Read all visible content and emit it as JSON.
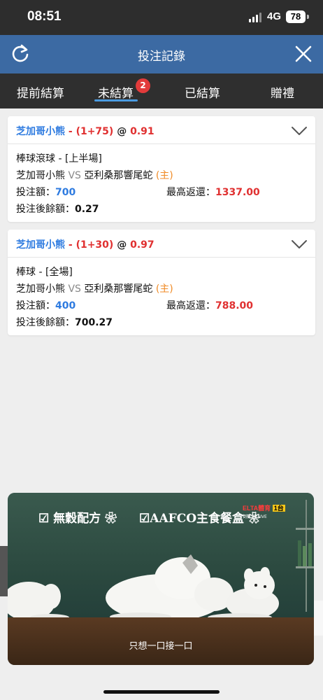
{
  "status_bar": {
    "time": "08:51",
    "network": "4G",
    "battery": "78"
  },
  "header": {
    "title": "投注記錄",
    "refresh_icon": "refresh-icon",
    "close_icon": "close-icon"
  },
  "tabs": [
    {
      "label": "提前結算",
      "active": false
    },
    {
      "label": "未結算",
      "active": true,
      "badge": "2"
    },
    {
      "label": "已結算",
      "active": false
    },
    {
      "label": "贈禮",
      "active": false
    }
  ],
  "bets": [
    {
      "team": "芝加哥小熊",
      "sep": " - ",
      "handicap": "(1+75)",
      "at": " @ ",
      "odds": "0.91",
      "market": "棒球滾球 - [上半場]",
      "home_team": "芝加哥小熊",
      "vs": " VS ",
      "away_team": "亞利桑那響尾蛇",
      "home_tag": " (主)",
      "stake_label": "投注額：",
      "stake": "700",
      "max_return_label": "最高返還：",
      "max_return": "1337.00",
      "balance_label": "投注後餘額：",
      "balance": "0.27"
    },
    {
      "team": "芝加哥小熊",
      "sep": " - ",
      "handicap": "(1+30)",
      "at": " @ ",
      "odds": "0.97",
      "market": "棒球 - [全場]",
      "home_team": "芝加哥小熊",
      "vs": " VS ",
      "away_team": "亞利桑那響尾蛇",
      "home_tag": " (主)",
      "stake_label": "投注額：",
      "stake": "400",
      "max_return_label": "最高返還：",
      "max_return": "788.00",
      "balance_label": "投注後餘額：",
      "balance": "700.27"
    }
  ],
  "ad": {
    "slogan_1": "無穀配方",
    "slogan_2": "AAFCO主食餐盒",
    "logo_brand": "ELTA體育",
    "logo_channel": "1台",
    "logo_sub": "倒數5天LIVE",
    "caption": "只想一口接一口"
  },
  "colors": {
    "header": "#3c6aa3",
    "tabbar": "#2f2f2f",
    "link_blue": "#2e7be0",
    "accent_red": "#e03030",
    "home_orange": "#f08a24",
    "badge_red": "#e23b3b"
  }
}
